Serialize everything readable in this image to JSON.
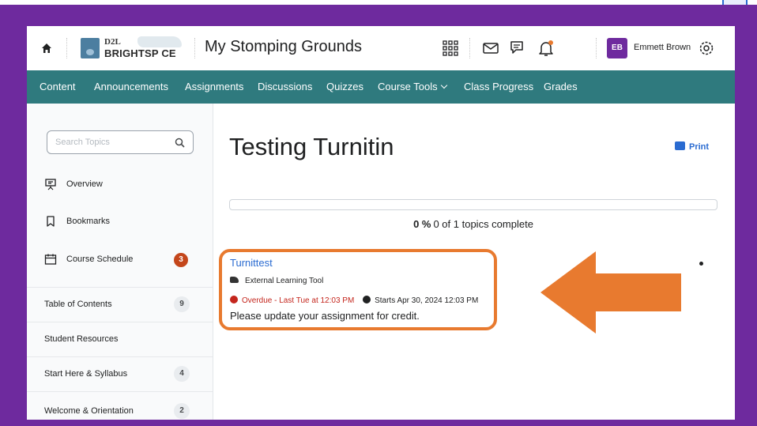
{
  "header": {
    "logo_top": "D2L",
    "logo_bottom": "BRIGHTSP CE",
    "course_title": "My Stomping Grounds",
    "user_initials": "EB",
    "user_name": "Emmett Brown"
  },
  "nav": {
    "items": [
      "Content",
      "Announcements",
      "Assignments",
      "Discussions",
      "Quizzes",
      "Course Tools",
      "Class Progress",
      "Grades"
    ]
  },
  "sidebar": {
    "search_placeholder": "Search Topics",
    "items": [
      {
        "label": "Overview",
        "icon": "presentation-icon"
      },
      {
        "label": "Bookmarks",
        "icon": "bookmark-icon"
      },
      {
        "label": "Course Schedule",
        "icon": "calendar-icon",
        "badge": "3"
      }
    ],
    "toc": [
      {
        "label": "Table of Contents",
        "count": "9"
      },
      {
        "label": "Student Resources",
        "count": ""
      },
      {
        "label": "Start Here & Syllabus",
        "count": "4"
      },
      {
        "label": "Welcome & Orientation",
        "count": "2"
      }
    ]
  },
  "main": {
    "title": "Testing Turnitin",
    "print_label": "Print",
    "progress": {
      "percent_label": "0 %",
      "status": "0 of 1 topics complete",
      "fraction": 0
    },
    "topic": {
      "name": "Turnittest",
      "type": "External Learning Tool",
      "due": "Overdue - Last Tue at 12:03 PM",
      "starts": "Starts Apr 30, 2024 12:03 PM",
      "description": "Please update your assignment for credit."
    }
  },
  "colors": {
    "frame": "#6e2a9e",
    "navbar": "#2f7a7e",
    "highlight": "#e87a2f",
    "link": "#2a6bd1",
    "overdue": "#c4261d"
  }
}
